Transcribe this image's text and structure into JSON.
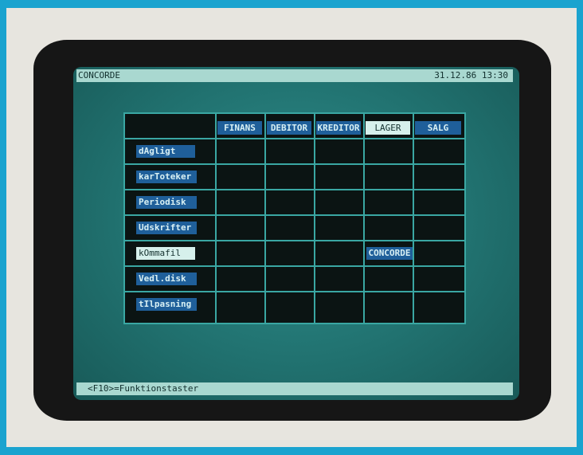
{
  "header": {
    "app_title": "CONCORDE",
    "datetime": "31.12.86 13:30"
  },
  "columns": [
    "FINANS",
    "DEBITOR",
    "KREDITOR",
    "LAGER",
    "SALG"
  ],
  "selected_column": "LAGER",
  "rows": [
    "dAgligt",
    "karToteker",
    "Periodisk",
    "Udskrifter",
    "kOmmafil",
    "Vedl.disk",
    "tIlpasning"
  ],
  "selected_row": "kOmmafil",
  "cell_entry": {
    "row": "kOmmafil",
    "column": "LAGER",
    "label": "CONCORDE"
  },
  "footer": {
    "hint": "<F10>=Funktionstaster"
  },
  "colors": {
    "screen_bg": "#217270",
    "bar_bg": "#a9d8d0",
    "label_bg": "#1f5f9a",
    "selected_bg": "#d6f0ec",
    "grid_line": "#3aa7a3"
  }
}
